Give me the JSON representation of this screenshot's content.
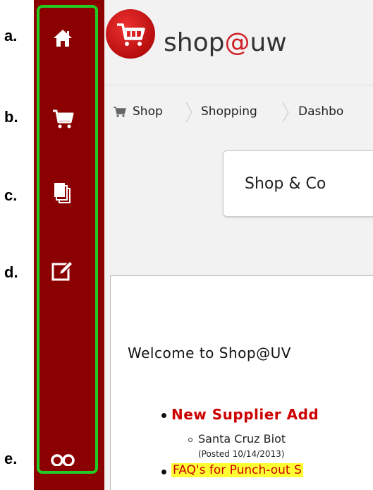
{
  "annotations": [
    "a.",
    "b.",
    "c.",
    "d.",
    "e."
  ],
  "sidebar": {
    "items": [
      {
        "icon": "home-icon"
      },
      {
        "icon": "cart-icon"
      },
      {
        "icon": "documents-icon"
      },
      {
        "icon": "edit-icon"
      },
      {
        "icon": "binoculars-icon"
      }
    ],
    "highlight_color": "#22cc22",
    "background": "#8b0000"
  },
  "header": {
    "logo_icon": "shopping-cart-logo-icon",
    "brand_prefix": "shop",
    "brand_at": "@",
    "brand_suffix": "uw"
  },
  "breadcrumb": {
    "icon": "cart-icon",
    "items": [
      "Shop",
      "Shopping",
      "Dashbo"
    ]
  },
  "card": {
    "title": "Shop & Co"
  },
  "content": {
    "welcome": "Welcome to Shop@UV",
    "news": [
      {
        "title": "New Supplier Add",
        "sub": "Santa Cruz Biot",
        "posted": "(Posted 10/14/2013)"
      },
      {
        "title": "FAQ's for Punch-out S"
      }
    ]
  }
}
